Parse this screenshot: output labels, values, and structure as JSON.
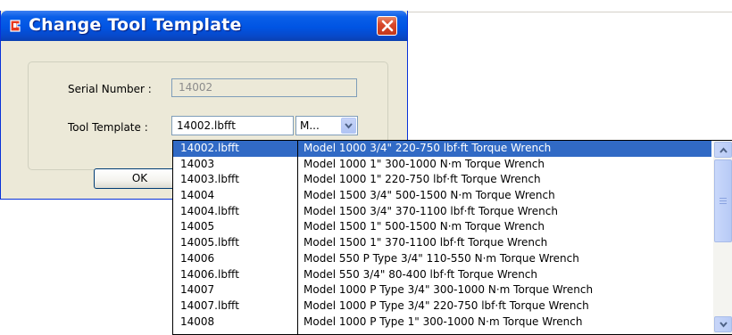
{
  "dialog": {
    "title": "Change Tool Template",
    "close_icon": "close-icon",
    "serial_label": "Serial Number :",
    "serial_value": "14002",
    "template_label": "Tool Template :",
    "template_value": "14002.lbfft",
    "template_combo_value": "M...",
    "ok_label": "OK"
  },
  "dropdown": {
    "rows": [
      {
        "id": "14002.lbfft",
        "desc": "Model 1000 3/4\" 220-750 lbf·ft Torque Wrench",
        "selected": true
      },
      {
        "id": "14003",
        "desc": "Model 1000 1\" 300-1000 N·m Torque Wrench"
      },
      {
        "id": "14003.lbfft",
        "desc": "Model 1000 1\" 220-750 lbf·ft Torque Wrench"
      },
      {
        "id": "14004",
        "desc": "Model 1500 3/4\" 500-1500 N·m Torque Wrench"
      },
      {
        "id": "14004.lbfft",
        "desc": "Model 1500 3/4\" 370-1100 lbf·ft Torque Wrench"
      },
      {
        "id": "14005",
        "desc": "Model 1500 1\" 500-1500 N·m Torque Wrench"
      },
      {
        "id": "14005.lbfft",
        "desc": "Model 1500 1\" 370-1100 lbf·ft Torque Wrench"
      },
      {
        "id": "14006",
        "desc": "Model 550 P Type 3/4\" 110-550 N·m Torque Wrench"
      },
      {
        "id": "14006.lbfft",
        "desc": "Model 550 3/4\" 80-400 lbf·ft Torque Wrench"
      },
      {
        "id": "14007",
        "desc": "Model 1000 P Type 3/4\" 300-1000 N·m Torque Wrench"
      },
      {
        "id": "14007.lbfft",
        "desc": "Model 1000 P Type 3/4\" 220-750 lbf·ft Torque Wrench"
      },
      {
        "id": "14008",
        "desc": "Model 1000 P Type 1\" 300-1000 N·m Torque Wrench"
      }
    ]
  },
  "colors": {
    "titlebar": "#0054e3",
    "selection": "#316ac5",
    "dialog_bg": "#ece9d8",
    "close_button": "#d8482b"
  }
}
